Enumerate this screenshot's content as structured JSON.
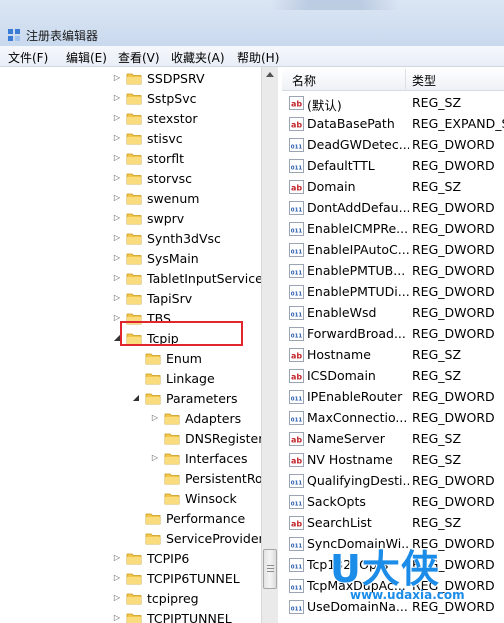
{
  "window": {
    "title": "注册表编辑器"
  },
  "menu": [
    "文件(F)",
    "编辑(E)",
    "查看(V)",
    "收藏夹(A)",
    "帮助(H)"
  ],
  "tree": [
    {
      "label": "SSDPSRV",
      "level": 0,
      "expander": "collapsed"
    },
    {
      "label": "SstpSvc",
      "level": 0,
      "expander": "collapsed"
    },
    {
      "label": "stexstor",
      "level": 0,
      "expander": "collapsed"
    },
    {
      "label": "stisvc",
      "level": 0,
      "expander": "collapsed"
    },
    {
      "label": "storflt",
      "level": 0,
      "expander": "collapsed"
    },
    {
      "label": "storvsc",
      "level": 0,
      "expander": "collapsed"
    },
    {
      "label": "swenum",
      "level": 0,
      "expander": "collapsed"
    },
    {
      "label": "swprv",
      "level": 0,
      "expander": "collapsed"
    },
    {
      "label": "Synth3dVsc",
      "level": 0,
      "expander": "collapsed"
    },
    {
      "label": "SysMain",
      "level": 0,
      "expander": "collapsed"
    },
    {
      "label": "TabletInputService",
      "level": 0,
      "expander": "collapsed"
    },
    {
      "label": "TapiSrv",
      "level": 0,
      "expander": "collapsed"
    },
    {
      "label": "TBS",
      "level": 0,
      "expander": "collapsed"
    },
    {
      "label": "Tcpip",
      "level": 0,
      "expander": "expanded"
    },
    {
      "label": "Enum",
      "level": 1,
      "expander": "none"
    },
    {
      "label": "Linkage",
      "level": 1,
      "expander": "none"
    },
    {
      "label": "Parameters",
      "level": 1,
      "expander": "expanded",
      "selected": true
    },
    {
      "label": "Adapters",
      "level": 2,
      "expander": "collapsed"
    },
    {
      "label": "DNSRegistere",
      "level": 2,
      "expander": "none"
    },
    {
      "label": "Interfaces",
      "level": 2,
      "expander": "collapsed"
    },
    {
      "label": "PersistentRou",
      "level": 2,
      "expander": "none"
    },
    {
      "label": "Winsock",
      "level": 2,
      "expander": "none"
    },
    {
      "label": "Performance",
      "level": 1,
      "expander": "none"
    },
    {
      "label": "ServiceProvider",
      "level": 1,
      "expander": "none"
    },
    {
      "label": "TCPIP6",
      "level": 0,
      "expander": "collapsed"
    },
    {
      "label": "TCPIP6TUNNEL",
      "level": 0,
      "expander": "collapsed"
    },
    {
      "label": "tcpipreg",
      "level": 0,
      "expander": "collapsed"
    },
    {
      "label": "TCPIPTUNNEL",
      "level": 0,
      "expander": "collapsed"
    }
  ],
  "columns": {
    "name": "名称",
    "type": "类型"
  },
  "values": [
    {
      "name": "(默认)",
      "type": "REG_SZ",
      "kind": "sz"
    },
    {
      "name": "DataBasePath",
      "type": "REG_EXPAND_S",
      "kind": "sz"
    },
    {
      "name": "DeadGWDetec...",
      "type": "REG_DWORD",
      "kind": "bin"
    },
    {
      "name": "DefaultTTL",
      "type": "REG_DWORD",
      "kind": "bin"
    },
    {
      "name": "Domain",
      "type": "REG_SZ",
      "kind": "sz"
    },
    {
      "name": "DontAddDefau...",
      "type": "REG_DWORD",
      "kind": "bin"
    },
    {
      "name": "EnableICMPRe...",
      "type": "REG_DWORD",
      "kind": "bin"
    },
    {
      "name": "EnableIPAutoC...",
      "type": "REG_DWORD",
      "kind": "bin"
    },
    {
      "name": "EnablePMTUB...",
      "type": "REG_DWORD",
      "kind": "bin"
    },
    {
      "name": "EnablePMTUDi...",
      "type": "REG_DWORD",
      "kind": "bin"
    },
    {
      "name": "EnableWsd",
      "type": "REG_DWORD",
      "kind": "bin"
    },
    {
      "name": "ForwardBroad...",
      "type": "REG_DWORD",
      "kind": "bin"
    },
    {
      "name": "Hostname",
      "type": "REG_SZ",
      "kind": "sz"
    },
    {
      "name": "ICSDomain",
      "type": "REG_SZ",
      "kind": "sz"
    },
    {
      "name": "IPEnableRouter",
      "type": "REG_DWORD",
      "kind": "bin"
    },
    {
      "name": "MaxConnectio...",
      "type": "REG_DWORD",
      "kind": "bin"
    },
    {
      "name": "NameServer",
      "type": "REG_SZ",
      "kind": "sz"
    },
    {
      "name": "NV Hostname",
      "type": "REG_SZ",
      "kind": "sz"
    },
    {
      "name": "QualifyingDesti...",
      "type": "REG_DWORD",
      "kind": "bin"
    },
    {
      "name": "SackOpts",
      "type": "REG_DWORD",
      "kind": "bin"
    },
    {
      "name": "SearchList",
      "type": "REG_SZ",
      "kind": "sz"
    },
    {
      "name": "SyncDomainWi...",
      "type": "REG_DWORD",
      "kind": "bin"
    },
    {
      "name": "Tcp1323Opts",
      "type": "REG_DWORD",
      "kind": "bin"
    },
    {
      "name": "TcpMaxDupAc...",
      "type": "REG_DWORD",
      "kind": "bin"
    },
    {
      "name": "UseDomainNa...",
      "type": "REG_DWORD",
      "kind": "bin"
    }
  ],
  "watermark": {
    "logo": "U大侠",
    "url": "www.udaxia.com"
  },
  "colors": {
    "folder": "#f2c64a",
    "selection_outline": "#e2262d",
    "watermark": "#1b8ce8"
  }
}
